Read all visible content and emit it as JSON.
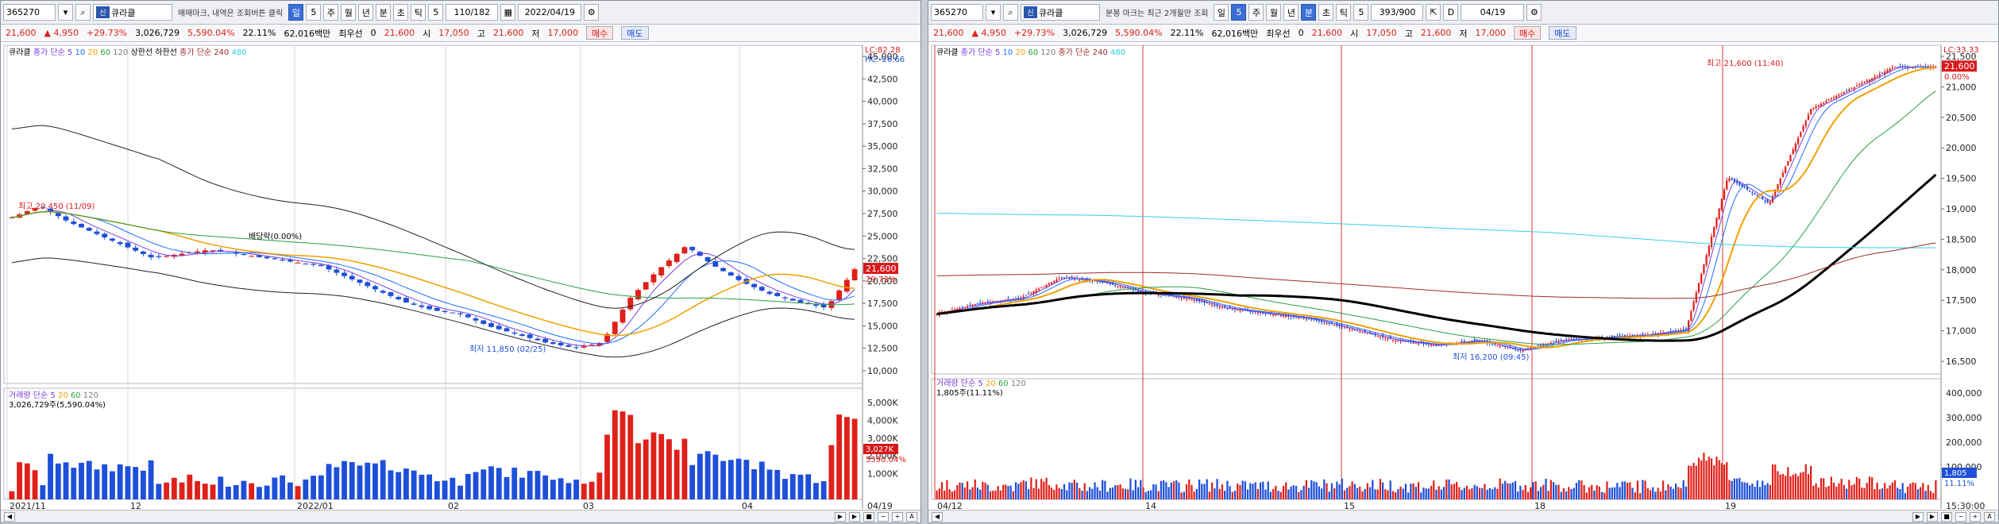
{
  "left": {
    "toolbar": {
      "code": "365270",
      "badge": "신",
      "name": "큐라클",
      "hint": "매매마크, 내역은 조회버튼 클릭",
      "period_buttons": [
        "일",
        "5",
        "주",
        "월",
        "년",
        "분",
        "초",
        "틱"
      ],
      "selected_period": "일",
      "interval": "5",
      "count": "110/182",
      "date": "2022/04/19"
    },
    "quote": {
      "price": "21,600",
      "change": "4,950",
      "rate": "+29.73%",
      "volume": "3,026,729",
      "volume_rate": "5,590.04%",
      "turnover": "22.11%",
      "amount": "62,016백만",
      "pref_label": "최우선",
      "pref_qty": "0",
      "pref_price": "21,600",
      "open_label": "시",
      "open": "17,050",
      "high_label": "고",
      "high": "21,600",
      "low_label": "저",
      "low": "17,000",
      "buy": "매수",
      "sell": "매도"
    },
    "price_legend": {
      "name": "큐라클",
      "ma_label": "종가 단순",
      "periods": [
        "5",
        "10",
        "20",
        "60",
        "120"
      ],
      "extra": "상한선 하한선",
      "long_label": "종가 단순 240",
      "long_period": "480"
    },
    "right_axis_note": "LC:82.28",
    "right_axis_note2": "HC:-26.66",
    "y_ticks": [
      "45,000",
      "42,500",
      "40,000",
      "37,500",
      "35,000",
      "32,500",
      "30,000",
      "27,500",
      "25,000",
      "22,500",
      "20,000",
      "17,500",
      "15,000",
      "12,500",
      "10,000"
    ],
    "current_price": "21,600",
    "current_rate": "29.73%",
    "annotations": {
      "high": "최고 29,450 (11/09)",
      "low": "최저 11,850 (02/25)",
      "mid": "배당락(0.00%)"
    },
    "volume_legend": {
      "label": "거래량",
      "ma_label": "단순",
      "periods": [
        "5",
        "20",
        "60",
        "120"
      ],
      "value": "3,026,729주(5,590.04%)"
    },
    "vol_ticks": [
      "5,000K",
      "4,000K",
      "3,000K",
      "2,000K",
      "1,000K"
    ],
    "vol_current": "3,027K",
    "vol_current_pct": "5590.04%",
    "x_ticks": [
      "2021/11",
      "12",
      "2022/01",
      "02",
      "03",
      "04"
    ],
    "x_end": "04/19",
    "chart_data": {
      "type": "candlestick",
      "title": "큐라클 일봉",
      "y_range": [
        9000,
        48000
      ],
      "high": {
        "value": 29450,
        "date": "11/09"
      },
      "low": {
        "value": 11850,
        "date": "02/25"
      },
      "last": {
        "open": 17050,
        "high": 21600,
        "low": 17000,
        "close": 21600
      }
    }
  },
  "right": {
    "toolbar": {
      "code": "365270",
      "badge": "신",
      "name": "큐라클",
      "hint": "분봉 마크는 최근 2개월만 조회",
      "period_buttons": [
        "일",
        "5",
        "주",
        "월",
        "년",
        "분",
        "초",
        "틱"
      ],
      "selected_period": "분",
      "interval": "5",
      "count": "393/900",
      "date_prefix": "D",
      "date": "04/19"
    },
    "quote": {
      "price": "21,600",
      "change": "4,950",
      "rate": "+29.73%",
      "volume": "3,026,729",
      "volume_rate": "5,590.04%",
      "turnover": "22.11%",
      "amount": "62,016백만",
      "pref_label": "최우선",
      "pref_qty": "0",
      "pref_price": "21,600",
      "open_label": "시",
      "open": "17,050",
      "high_label": "고",
      "high": "21,600",
      "low_label": "저",
      "low": "17,000",
      "buy": "매수",
      "sell": "매도"
    },
    "price_legend": {
      "name": "큐라클",
      "ma_label": "종가 단순",
      "periods": [
        "5",
        "10",
        "20",
        "60",
        "120"
      ],
      "long_label": "종가 단순 240",
      "long_period": "480"
    },
    "right_axis_note": "LC:33.33",
    "y_ticks": [
      "21,500",
      "21,000",
      "20,500",
      "20,000",
      "19,500",
      "19,000",
      "18,500",
      "18,000",
      "17,500",
      "17,000",
      "16,500"
    ],
    "current_price": "21,600",
    "current_rate": "0.00%",
    "annotations": {
      "high": "최고 21,600 (11:40)",
      "low": "최저 16,200 (09:45)"
    },
    "volume_legend": {
      "label": "거래량",
      "ma_label": "단순",
      "periods": [
        "5",
        "20",
        "60",
        "120"
      ],
      "value": "1,805주(11.11%)"
    },
    "vol_ticks": [
      "400,000",
      "300,000",
      "200,000",
      "100,000"
    ],
    "vol_current": "1,805",
    "vol_current_pct": "11.11%",
    "x_ticks": [
      "04/12",
      "14",
      "15",
      "18",
      "19"
    ],
    "x_end": "15:30:00",
    "chart_data": {
      "type": "candlestick",
      "title": "큐라클 5분봉",
      "y_range": [
        16000,
        21800
      ],
      "high": {
        "value": 21600,
        "time": "11:40"
      },
      "low": {
        "value": 16200,
        "time": "09:45"
      }
    }
  },
  "colors": {
    "up": "#e0201a",
    "down": "#1d4fd8",
    "ma5": "#7b3fd6",
    "ma10": "#1f6bff",
    "ma20": "#f0a000",
    "ma60": "#27a040",
    "ma120": "#7a7a7a",
    "ma240": "#9b2b2b",
    "ma480": "#2fd0e8"
  }
}
